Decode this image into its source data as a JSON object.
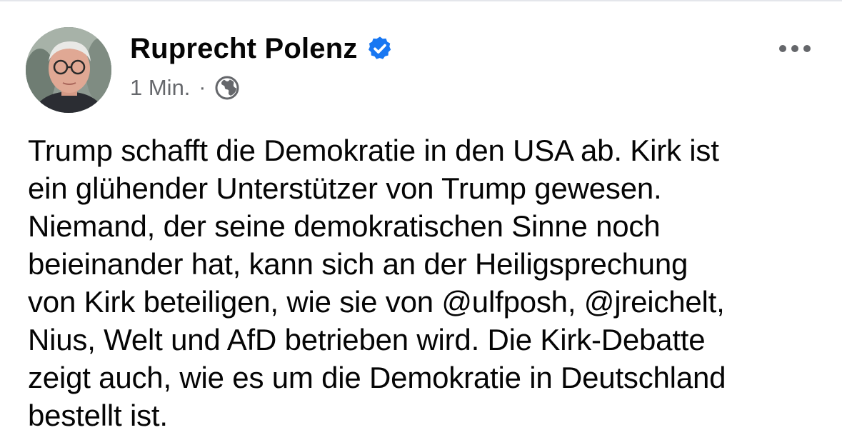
{
  "post": {
    "author": {
      "name": "Ruprecht Polenz",
      "verified": true,
      "verified_icon": "verified-badge-icon",
      "avatar_icon": "profile-photo"
    },
    "meta": {
      "timestamp": "1 Min.",
      "separator": "·",
      "audience_icon": "globe-icon"
    },
    "more_icon": "more-options-icon",
    "text": "Trump schafft die Demokratie in den USA ab. Kirk ist\nein glühender Unterstützer von Trump gewesen.\nNiemand, der seine demokratischen Sinne noch\nbeieinander hat, kann sich an der Heiligsprechung\nvon Kirk beteiligen, wie sie von @ulfposh, @jreichelt,\nNius, Welt und AfD betrieben wird. Die Kirk-Debatte\nzeigt auch, wie es um die Demokratie in Deutschland\nbestellt ist."
  },
  "colors": {
    "text_primary": "#050505",
    "text_secondary": "#65676b",
    "verified_blue": "#1877f2",
    "divider": "#e4e6eb"
  }
}
